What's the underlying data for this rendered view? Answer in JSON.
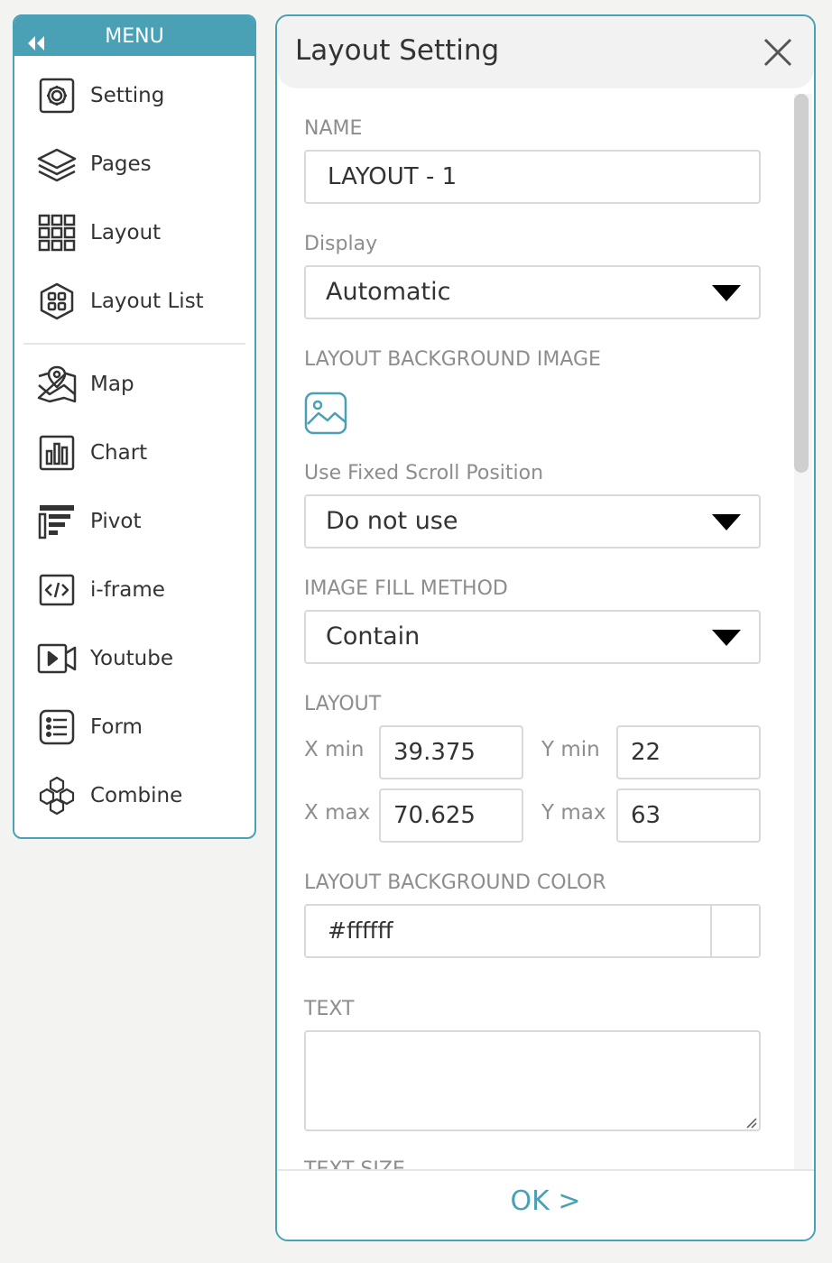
{
  "menu": {
    "title": "MENU",
    "items": [
      {
        "label": "Setting",
        "icon": "gear-icon"
      },
      {
        "label": "Pages",
        "icon": "layers-icon"
      },
      {
        "label": "Layout",
        "icon": "grid-icon"
      },
      {
        "label": "Layout List",
        "icon": "hexagon-grid-icon"
      },
      {
        "label": "Map",
        "icon": "map-pin-icon"
      },
      {
        "label": "Chart",
        "icon": "bar-chart-icon"
      },
      {
        "label": "Pivot",
        "icon": "pivot-icon"
      },
      {
        "label": "i-frame",
        "icon": "code-icon"
      },
      {
        "label": "Youtube",
        "icon": "video-icon"
      },
      {
        "label": "Form",
        "icon": "list-icon"
      },
      {
        "label": "Combine",
        "icon": "hexagons-icon"
      }
    ]
  },
  "dialog": {
    "title": "Layout Setting",
    "name_label": "NAME",
    "name_value": "LAYOUT - 1",
    "display_label": "Display",
    "display_value": "Automatic",
    "bg_image_label": "LAYOUT BACKGROUND IMAGE",
    "fixed_scroll_label": "Use Fixed Scroll Position",
    "fixed_scroll_value": "Do not use",
    "fill_method_label": "IMAGE FILL METHOD",
    "fill_method_value": "Contain",
    "layout_label": "LAYOUT",
    "x_min_label": "X min",
    "x_min_value": "39.375",
    "y_min_label": "Y min",
    "y_min_value": "22",
    "x_max_label": "X max",
    "x_max_value": "70.625",
    "y_max_label": "Y max",
    "y_max_value": "63",
    "bg_color_label": "LAYOUT BACKGROUND COLOR",
    "bg_color_value": "#ffffff",
    "text_label": "TEXT",
    "text_size_label": "TEXT SIZE",
    "ok_label": "OK >"
  },
  "colors": {
    "accent": "#4aa0b5",
    "background": "#f3f3f2"
  }
}
